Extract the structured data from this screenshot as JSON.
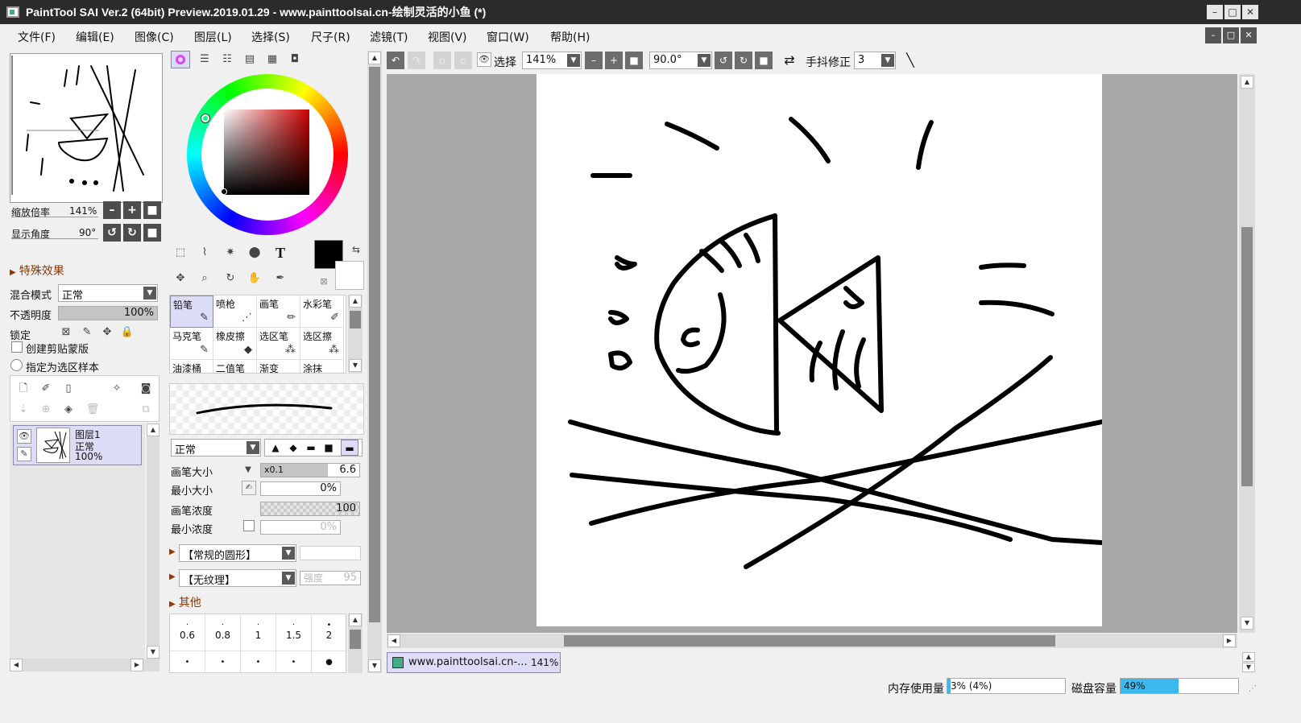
{
  "window": {
    "title": "PaintTool SAI Ver.2 (64bit) Preview.2019.01.29 - www.painttoolsai.cn-绘制灵活的小鱼 (*)",
    "controls": [
      "–",
      "□",
      "✕"
    ]
  },
  "menu": [
    "文件(F)",
    "编辑(E)",
    "图像(C)",
    "图层(L)",
    "选择(S)",
    "尺子(R)",
    "滤镜(T)",
    "视图(V)",
    "窗口(W)",
    "帮助(H)"
  ],
  "navigator": {
    "zoom_label": "缩放倍率",
    "zoom_value": "141%",
    "angle_label": "显示角度",
    "angle_value": "90°"
  },
  "layer_panel": {
    "effects_title": "特殊效果",
    "blend_label": "混合模式",
    "blend_value": "正常",
    "opacity_label": "不透明度",
    "opacity_value": "100%",
    "opacity": 1.0,
    "lock_label": "锁定",
    "clip_label": "创建剪贴蒙版",
    "sample_label": "指定为选区样本",
    "layer": {
      "name": "图层1",
      "mode": "正常",
      "opacity": "100%"
    }
  },
  "tools": {
    "text_tool": "T",
    "brushes": [
      {
        "name": "铅笔",
        "selected": true
      },
      {
        "name": "喷枪"
      },
      {
        "name": "画笔"
      },
      {
        "name": "水彩笔"
      },
      {
        "name": "马克笔"
      },
      {
        "name": "橡皮擦"
      },
      {
        "name": "选区笔"
      },
      {
        "name": "选区擦"
      },
      {
        "name": "油漆桶"
      },
      {
        "name": "二值笔"
      },
      {
        "name": "渐变"
      },
      {
        "name": "涂抹"
      }
    ],
    "blend_value": "正常",
    "size_label": "画笔大小",
    "size_mult": "x0.1",
    "size_value": "6.6",
    "min_size_label": "最小大小",
    "min_size_value": "0%",
    "density_label": "画笔浓度",
    "density_value": "100",
    "min_density_label": "最小浓度",
    "min_density_value": "0%",
    "shape_value": "【常规的圆形】",
    "texture_value": "【无纹理】",
    "strength_label": "强度",
    "strength_value": "95",
    "other_title": "其他",
    "dot_sizes": [
      "0.6",
      "0.8",
      "1",
      "1.5",
      "2"
    ]
  },
  "canvas_toolbar": {
    "select_label": "选择",
    "zoom_value": "141%",
    "angle_value": "90.0°",
    "stabilizer_label": "手抖修正",
    "stabilizer_value": "3"
  },
  "doc_tab": {
    "name": "www.painttoolsai.cn-...",
    "zoom": "141%"
  },
  "status": {
    "memory_label": "内存使用量",
    "memory_value": "3% (4%)",
    "memory_fraction": 0.03,
    "disk_label": "磁盘容量",
    "disk_value": "49%",
    "disk_fraction": 0.49
  },
  "colors": {
    "titlebar": "#2b2b2b",
    "accent_bar": "#39b9ec",
    "selection": "#dcdcf6",
    "foreground": "#000000",
    "background": "#ffffff"
  }
}
